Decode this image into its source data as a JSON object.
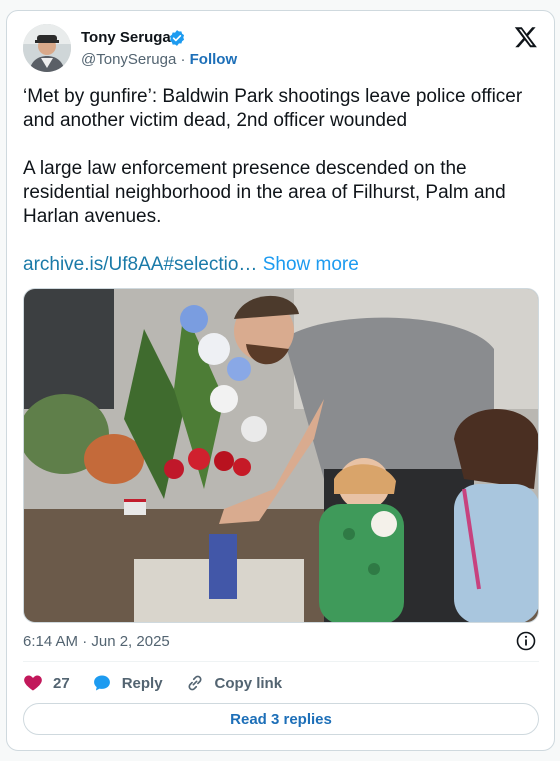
{
  "author": {
    "name": "Tony Seruga",
    "handle": "@TonySeruga",
    "separator": "·",
    "follow_label": "Follow",
    "verified": true,
    "verified_color": "#1d9bf0"
  },
  "platform_icon": "x-logo-icon",
  "tweet": {
    "headline": "‘Met by gunfire’: Baldwin Park shootings leave police officer and another victim dead, 2nd officer wounded",
    "body": "A large law enforcement presence descended on the residential neighborhood in the area of Filhurst, Palm and Harlan avenues.",
    "link_text": "archive.is/Uf8AA#selectio…",
    "show_more_label": "Show more"
  },
  "timestamp": "6:14 AM · Jun 2, 2025",
  "actions": {
    "like_count": "27",
    "reply_label": "Reply",
    "copy_link_label": "Copy link"
  },
  "read_replies_label": "Read 3 replies",
  "colors": {
    "link": "#1a7aa8",
    "heart": "#c2185b",
    "accent": "#1d9bf0"
  }
}
